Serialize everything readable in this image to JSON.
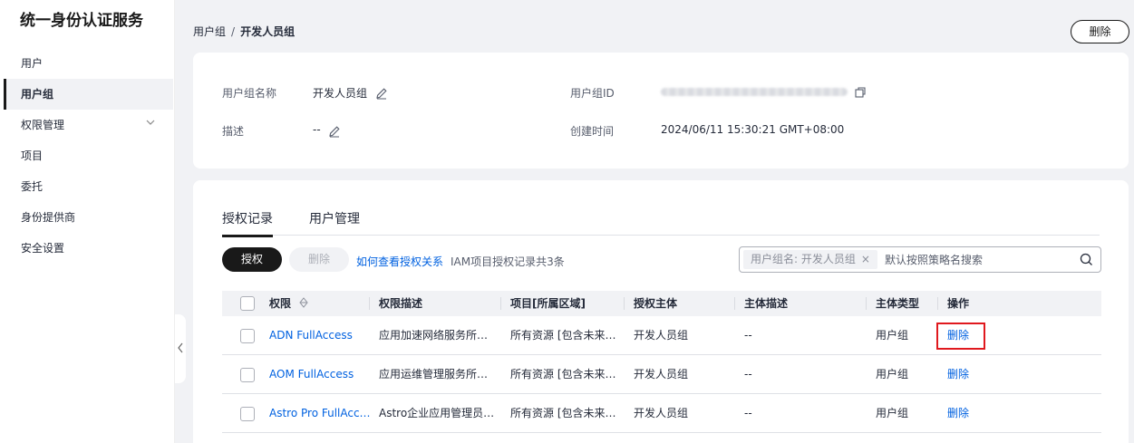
{
  "sidebar": {
    "title": "统一身份认证服务",
    "items": [
      {
        "label": "用户"
      },
      {
        "label": "用户组"
      },
      {
        "label": "权限管理"
      },
      {
        "label": "项目"
      },
      {
        "label": "委托"
      },
      {
        "label": "身份提供商"
      },
      {
        "label": "安全设置"
      }
    ],
    "active_index": 1
  },
  "breadcrumb": {
    "parent": "用户组",
    "separator": "/",
    "current": "开发人员组"
  },
  "header": {
    "delete_label": "删除"
  },
  "info": {
    "group_name_label": "用户组名称",
    "group_name_value": "开发人员组",
    "desc_label": "描述",
    "desc_value": "--",
    "group_id_label": "用户组ID",
    "created_label": "创建时间",
    "created_value": "2024/06/11 15:30:21 GMT+08:00"
  },
  "tabs": [
    {
      "label": "授权记录",
      "active": true
    },
    {
      "label": "用户管理",
      "active": false
    }
  ],
  "toolbar": {
    "authorize_label": "授权",
    "delete_label": "删除",
    "help_link": "如何查看授权关系",
    "count_text": "IAM项目授权记录共3条"
  },
  "search": {
    "chip_label": "用户组名: 开发人员组",
    "placeholder": "默认按照策略名搜索"
  },
  "table": {
    "columns": [
      "权限",
      "权限描述",
      "项目[所属区域]",
      "授权主体",
      "主体描述",
      "主体类型",
      "操作"
    ],
    "rows": [
      {
        "policy": "ADN FullAccess",
        "desc": "应用加速网络服务所…",
        "project": "所有资源 [包含未来…",
        "principal": "开发人员组",
        "principal_desc": "--",
        "principal_type": "用户组",
        "action": "删除",
        "highlighted": true
      },
      {
        "policy": "AOM FullAccess",
        "desc": "应用运维管理服务所…",
        "project": "所有资源 [包含未来…",
        "principal": "开发人员组",
        "principal_desc": "--",
        "principal_type": "用户组",
        "action": "删除",
        "highlighted": false
      },
      {
        "policy": "Astro Pro FullAcc…",
        "desc": "Astro企业应用管理员…",
        "project": "所有资源 [包含未来…",
        "principal": "开发人员组",
        "principal_desc": "--",
        "principal_type": "用户组",
        "action": "删除",
        "highlighted": false
      }
    ]
  },
  "colors": {
    "link": "#0061e0",
    "primary_button": "#191919",
    "highlight_border": "#e0191e"
  }
}
